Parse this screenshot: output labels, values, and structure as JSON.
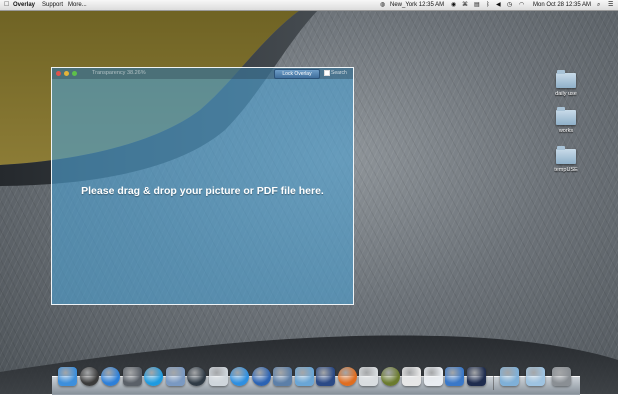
{
  "menubar": {
    "app_name": "Overlay",
    "menus": [
      "Support",
      "More..."
    ],
    "clock": "New_York 12:35 AM",
    "datetime": "Mon Oct 28 12:35 AM"
  },
  "overlay_window": {
    "title": "Transparency 38.26%",
    "lock_button": "Lock Overlay",
    "search_option": "Search",
    "drop_hint": "Please drag & drop your picture or PDF file here."
  },
  "desktop_items": [
    {
      "label": "daily use",
      "icon": "folder-icon"
    },
    {
      "label": "works",
      "icon": "folder-icon"
    },
    {
      "label": "tempUSE",
      "icon": "folder-icon"
    }
  ],
  "dock": {
    "apps": [
      {
        "name": "finder-icon",
        "color": "#3d8fdc"
      },
      {
        "name": "dashboard-icon",
        "color": "#3b3b3b"
      },
      {
        "name": "itunes-icon",
        "color": "#2d7fd8"
      },
      {
        "name": "launchpad-icon",
        "color": "#5a6068"
      },
      {
        "name": "skype-icon",
        "color": "#1e9be0"
      },
      {
        "name": "preview-icon",
        "color": "#7a99c2"
      },
      {
        "name": "webcam-icon",
        "color": "#2f3a45"
      },
      {
        "name": "screenshot-icon",
        "color": "#cfd6dc"
      },
      {
        "name": "app-store-icon",
        "color": "#2e8fe0"
      },
      {
        "name": "google-earth-icon",
        "color": "#2b63b4"
      },
      {
        "name": "xcode-icon",
        "color": "#5c7fa8"
      },
      {
        "name": "mail-icon",
        "color": "#6aa6d6"
      },
      {
        "name": "instruments-icon",
        "color": "#2b4a86"
      },
      {
        "name": "firefox-icon",
        "color": "#e06d1f"
      },
      {
        "name": "overlay-icon",
        "color": "#d9dde0"
      },
      {
        "name": "color-picker-icon",
        "color": "#6b7b2d"
      },
      {
        "name": "pdf-icon",
        "color": "#e7e7e7"
      },
      {
        "name": "textedit-icon",
        "color": "#e9edf2"
      },
      {
        "name": "script-icon",
        "color": "#3a78c8"
      },
      {
        "name": "terminal-icon",
        "color": "#1f2d4f"
      }
    ],
    "folders": [
      {
        "name": "downloads-folder-icon",
        "color": "#7fb0d8"
      },
      {
        "name": "documents-folder-icon",
        "color": "#9ec3e1"
      },
      {
        "name": "trash-icon",
        "color": "#8a8f94"
      }
    ]
  }
}
